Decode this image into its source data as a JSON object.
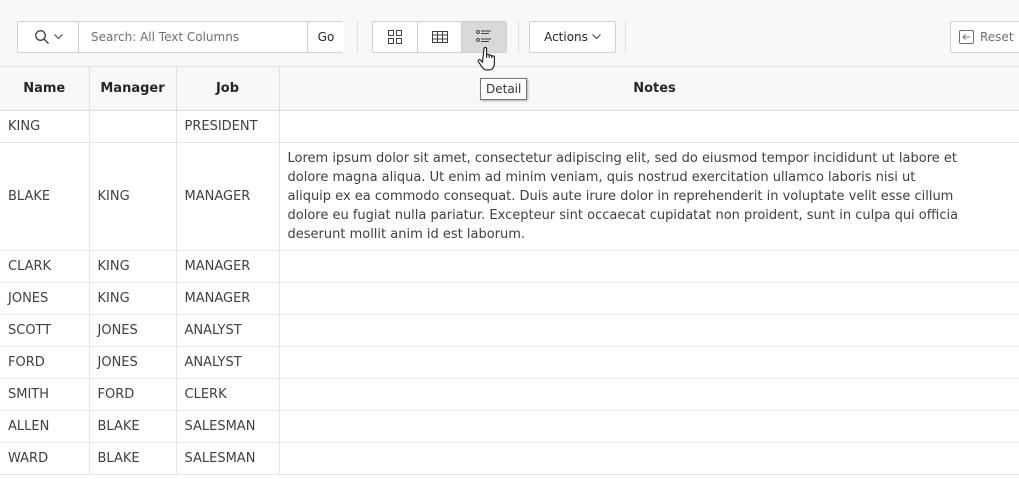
{
  "toolbar": {
    "search_placeholder": "Search: All Text Columns",
    "go_label": "Go",
    "actions_label": "Actions",
    "reset_label": "Reset",
    "active_view": "detail",
    "views": [
      "icon",
      "report",
      "detail"
    ]
  },
  "tooltip": {
    "text": "Detail"
  },
  "table": {
    "headers": [
      "Name",
      "Manager",
      "Job",
      "Notes"
    ],
    "rows": [
      {
        "name": "KING",
        "manager": "",
        "job": "PRESIDENT",
        "notes": []
      },
      {
        "name": "BLAKE",
        "manager": "KING",
        "job": "MANAGER",
        "notes": [
          "Lorem ipsum dolor sit amet, consectetur adipiscing elit, sed do eiusmod tempor incididunt ut labore et",
          "dolore magna aliqua. Ut enim ad minim veniam, quis nostrud exercitation ullamco laboris nisi ut",
          "aliquip ex ea commodo consequat. Duis aute irure dolor in reprehenderit in voluptate velit esse cillum",
          "dolore eu fugiat nulla pariatur. Excepteur sint occaecat cupidatat non proident, sunt in culpa qui officia",
          "deserunt mollit anim id est laborum."
        ]
      },
      {
        "name": "CLARK",
        "manager": "KING",
        "job": "MANAGER",
        "notes": []
      },
      {
        "name": "JONES",
        "manager": "KING",
        "job": "MANAGER",
        "notes": []
      },
      {
        "name": "SCOTT",
        "manager": "JONES",
        "job": "ANALYST",
        "notes": []
      },
      {
        "name": "FORD",
        "manager": "JONES",
        "job": "ANALYST",
        "notes": []
      },
      {
        "name": "SMITH",
        "manager": "FORD",
        "job": "CLERK",
        "notes": []
      },
      {
        "name": "ALLEN",
        "manager": "BLAKE",
        "job": "SALESMAN",
        "notes": []
      },
      {
        "name": "WARD",
        "manager": "BLAKE",
        "job": "SALESMAN",
        "notes": []
      }
    ]
  }
}
